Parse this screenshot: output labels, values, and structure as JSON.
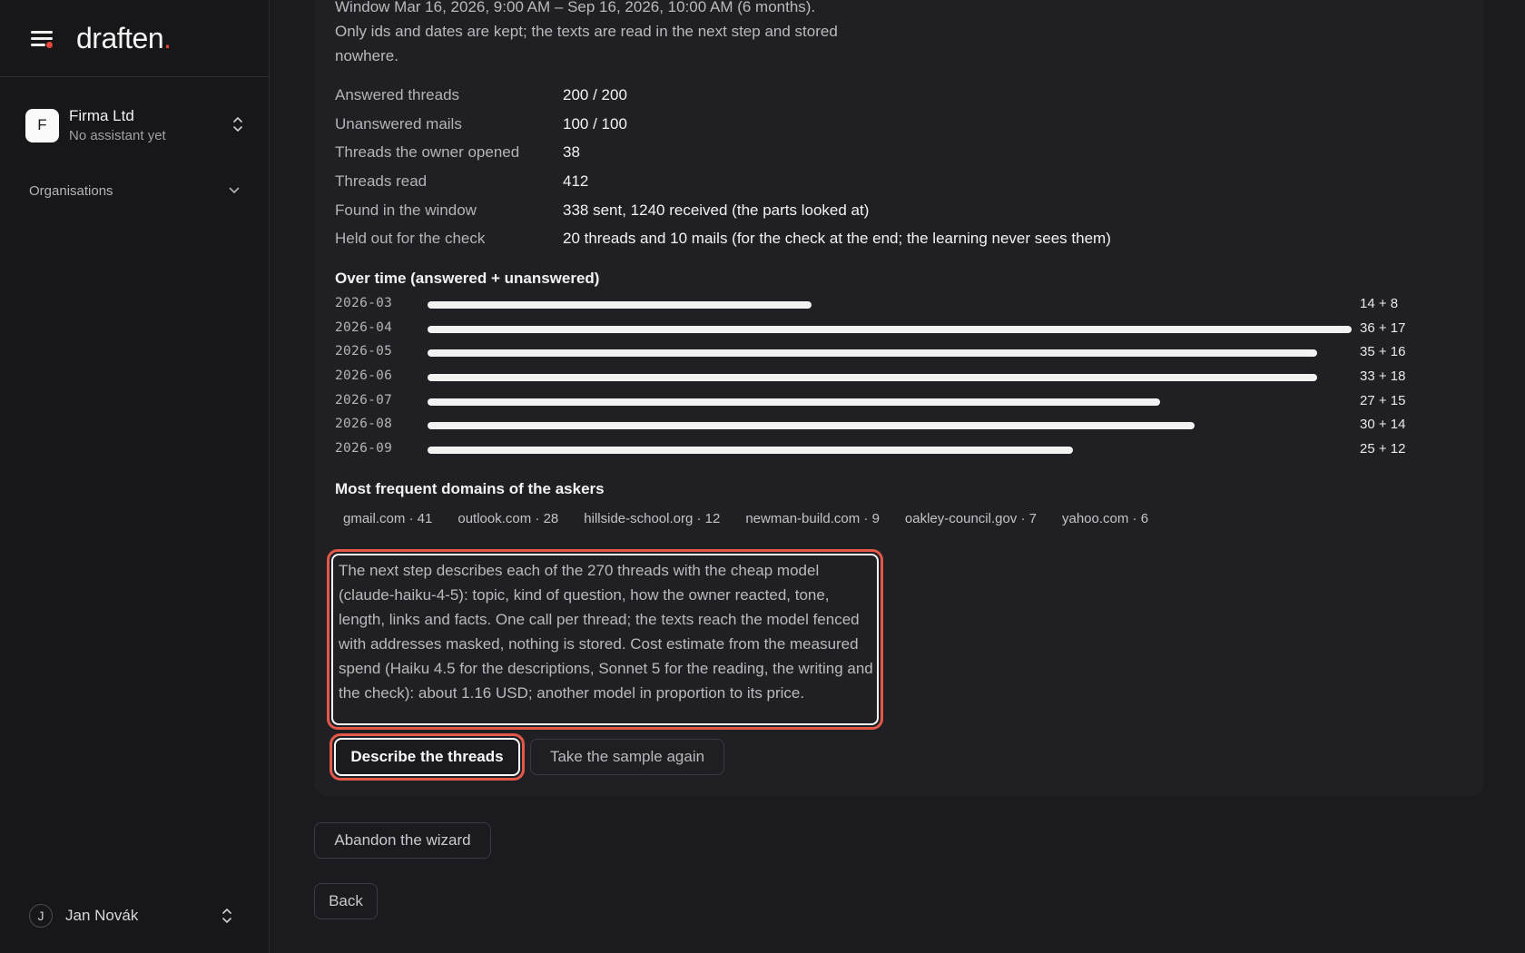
{
  "sidebar": {
    "logo_text": "draften",
    "logo_dot": ".",
    "org": {
      "initial": "F",
      "name": "Firma Ltd",
      "subtitle": "No assistant yet"
    },
    "organisations_label": "Organisations",
    "user": {
      "initial": "J",
      "name": "Jan Novák"
    }
  },
  "main": {
    "intro_line1": "Window Mar 16, 2026, 9:00 AM – Sep 16, 2026, 10:00 AM (6 months).",
    "intro_line2": "Only ids and dates are kept; the texts are read in the next step and stored nowhere.",
    "stats": [
      {
        "label": "Answered threads",
        "value": "200 / 200"
      },
      {
        "label": "Unanswered mails",
        "value": "100 / 100"
      },
      {
        "label": "Threads the owner opened",
        "value": "38"
      },
      {
        "label": "Threads read",
        "value": "412"
      },
      {
        "label": "Found in the window",
        "value": "338 sent, 1240 received (the parts looked at)"
      },
      {
        "label": "Held out for the check",
        "value": "20 threads and 10 mails (for the check at the end; the learning never sees them)"
      }
    ],
    "over_time_title": "Over time (answered + unanswered)",
    "domains_title": "Most frequent domains of the askers",
    "domains": [
      "gmail.com · 41",
      "outlook.com · 28",
      "hillside-school.org · 12",
      "newman-build.com · 9",
      "oakley-council.gov · 7",
      "yahoo.com · 6"
    ],
    "description": "The next step describes each of the 270 threads with the cheap model (claude-haiku-4-5): topic, kind of question, how the owner reacted, tone, length, links and facts. One call per thread; the texts reach the model fenced with addresses masked, nothing is stored. Cost estimate from the measured spend (Haiku 4.5 for the descriptions, Sonnet 5 for the reading, the writing and the check): about 1.16 USD; another model in proportion to its price.",
    "buttons": {
      "describe": "Describe the threads",
      "resample": "Take the sample again",
      "abandon": "Abandon the wizard",
      "back": "Back"
    }
  },
  "chart_data": {
    "type": "bar",
    "orientation": "horizontal",
    "title": "Over time (answered + unanswered)",
    "categories": [
      "2026-03",
      "2026-04",
      "2026-05",
      "2026-06",
      "2026-07",
      "2026-08",
      "2026-09"
    ],
    "series": [
      {
        "name": "answered",
        "values": [
          14,
          36,
          35,
          33,
          27,
          30,
          25
        ]
      },
      {
        "name": "unanswered",
        "values": [
          8,
          17,
          16,
          18,
          15,
          14,
          12
        ]
      }
    ],
    "labels": [
      "14 + 8",
      "36 + 17",
      "35 + 16",
      "33 + 18",
      "27 + 15",
      "30 + 14",
      "25 + 12"
    ],
    "bar_color": "#f2f2f2",
    "grid": false
  },
  "colors": {
    "accent": "#e5483a",
    "background": "#1b1b1f",
    "card": "#202024"
  }
}
